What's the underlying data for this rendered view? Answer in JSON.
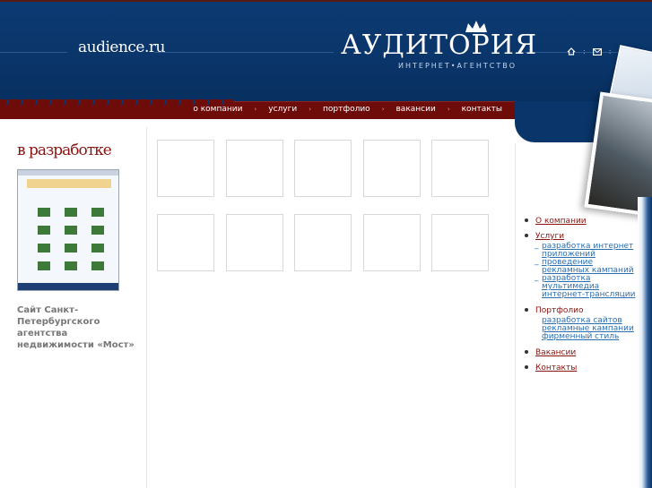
{
  "header": {
    "site_name": "audience.ru",
    "logo_text": "АУДИТОРИЯ",
    "logo_subtitle": "ИНТЕРНЕТ•АГЕНТСТВО",
    "icons": [
      "home-icon",
      "mail-icon",
      "sitemap-icon"
    ]
  },
  "nav": {
    "items": [
      "о компании",
      "услуги",
      "портфолио",
      "вакансии",
      "контакты"
    ]
  },
  "sidebar_left": {
    "title": "в разработке",
    "caption": "Сайт Санкт-Петербургского агентства недвижимости «Мост»"
  },
  "side_menu": {
    "company": "О компании",
    "services": "Услуги",
    "services_sub": [
      "разработка интернет приложений",
      "проведение рекламных кампаний",
      "разработка мультимедиа интернет-трансляции"
    ],
    "portfolio": "Портфолио",
    "portfolio_sub": [
      "разработка сайтов",
      "рекламные кампании",
      "фирменный стиль"
    ],
    "vacancies": "Вакансии",
    "contacts": "Контакты"
  },
  "colors": {
    "header_blue": "#0a356a",
    "nav_red": "#6e0c0a",
    "accent_red": "#8a1410",
    "link_blue": "#2b6fb3"
  }
}
